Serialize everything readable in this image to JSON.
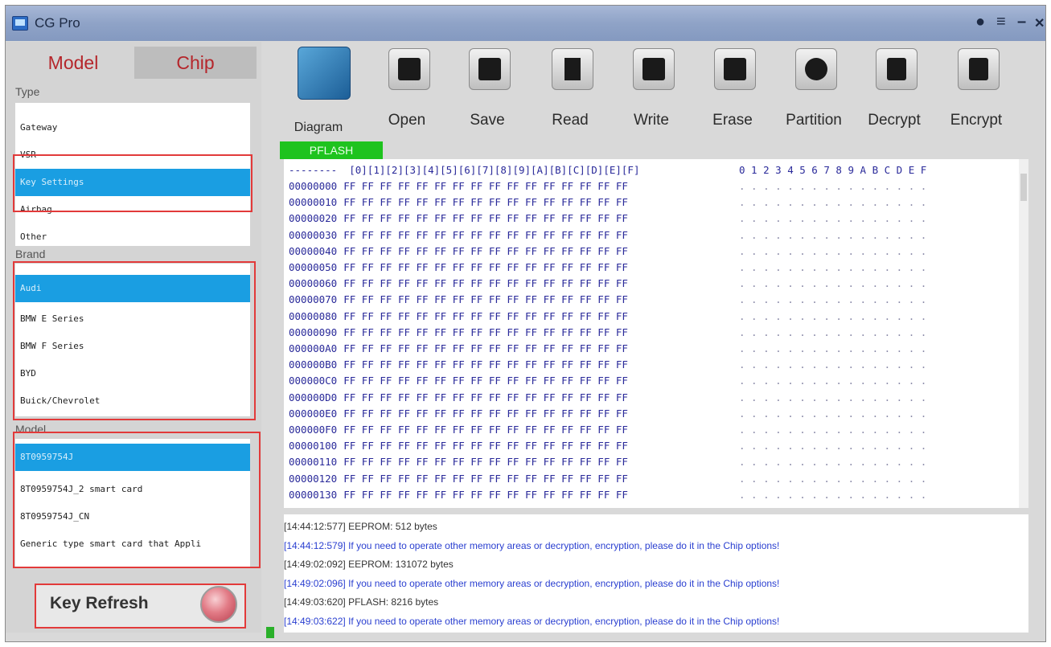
{
  "app": {
    "title": "CG Pro"
  },
  "window_controls": [
    "person-icon",
    "menu-icon",
    "minimize-icon",
    "close-icon"
  ],
  "left_panel": {
    "tabs": [
      "Model",
      "Chip"
    ],
    "type_label": "Type",
    "type_items": [
      "Gateway",
      "VSR",
      "Key Settings",
      "Airbag",
      "Other"
    ],
    "type_selected": "Key Settings",
    "brand_label": "Brand",
    "brand_items": [
      "Audi",
      "BMW E Series",
      "BMW F Series",
      "BYD",
      "Buick/Chevrolet"
    ],
    "brand_selected": "Audi",
    "model_label": "Model",
    "model_items": [
      "8T0959754J",
      "8T0959754J_2 smart card",
      "8T0959754J_CN",
      "Generic type smart card that Appli"
    ],
    "model_selected": "8T0959754J",
    "key_refresh_label": "Key Refresh"
  },
  "toolbar": {
    "buttons": [
      {
        "label": "Diagram",
        "icon": "diagram-icon"
      },
      {
        "label": "Open",
        "icon": "folder-icon"
      },
      {
        "label": "Save",
        "icon": "floppy-icon"
      },
      {
        "label": "Read",
        "icon": "hourglass-icon"
      },
      {
        "label": "Write",
        "icon": "pencil-icon"
      },
      {
        "label": "Erase",
        "icon": "eraser-icon"
      },
      {
        "label": "Partition",
        "icon": "pie-icon"
      },
      {
        "label": "Decrypt",
        "icon": "lock-icon"
      },
      {
        "label": "Encrypt",
        "icon": "lock-gear-icon"
      }
    ]
  },
  "memory_tag": "PFLASH",
  "hex": {
    "header_hex": "--------  [0][1][2][3][4][5][6][7][8][9][A][B][C][D][E][F]",
    "header_ascii": "0 1 2 3 4 5 6 7 8 9 A B C D E F",
    "rows": [
      "00000000",
      "00000010",
      "00000020",
      "00000030",
      "00000040",
      "00000050",
      "00000060",
      "00000070",
      "00000080",
      "00000090",
      "000000A0",
      "000000B0",
      "000000C0",
      "000000D0",
      "000000E0",
      "000000F0",
      "00000100",
      "00000110",
      "00000120",
      "00000130"
    ],
    "row_bytes": "FF FF FF FF FF FF FF FF FF FF FF FF FF FF FF FF",
    "row_ascii": ". . . . . . . . . . . . . . . ."
  },
  "log": [
    {
      "text": "[14:44:12:577]  EEPROM:  512  bytes",
      "kind": "info"
    },
    {
      "text": "[14:44:12:579]  If you need to operate other memory areas or decryption, encryption, please do it in the Chip options!",
      "kind": "notice"
    },
    {
      "text": "[14:49:02:092]  EEPROM:  131072  bytes",
      "kind": "info"
    },
    {
      "text": "[14:49:02:096]  If you need to operate other memory areas or decryption, encryption, please do it in the Chip options!",
      "kind": "notice"
    },
    {
      "text": "[14:49:03:620]  PFLASH:  8216  bytes",
      "kind": "info"
    },
    {
      "text": "[14:49:03:622]  If you need to operate other memory areas or decryption, encryption, please do it in the Chip options!",
      "kind": "notice"
    }
  ]
}
